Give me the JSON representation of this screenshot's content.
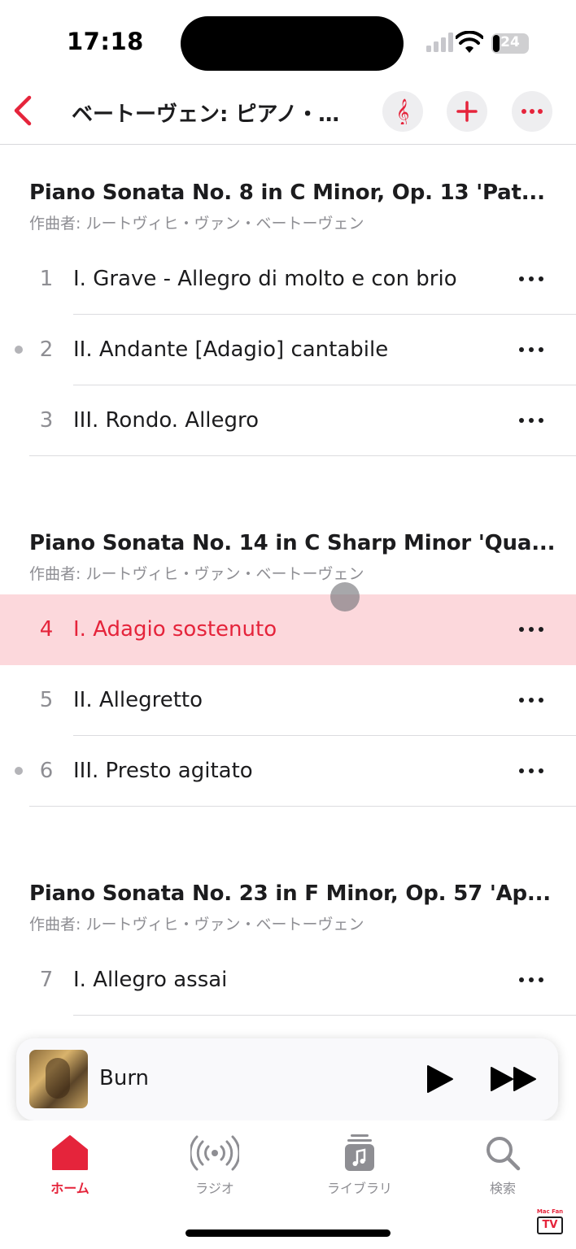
{
  "status_bar": {
    "time": "17:18",
    "battery": "24"
  },
  "nav": {
    "title": "ベートーヴェン: ピアノ・…"
  },
  "sections": [
    {
      "title": "Piano Sonata No. 8 in C Minor, Op. 13 'Pat...",
      "composer": "作曲者: ルートヴィヒ・ヴァン・ベートーヴェン",
      "tracks": [
        {
          "num": "1",
          "name": "I. Grave - Allegro di molto e con brio"
        },
        {
          "num": "2",
          "name": "II. Andante [Adagio] cantabile"
        },
        {
          "num": "3",
          "name": "III. Rondo. Allegro"
        }
      ]
    },
    {
      "title": "Piano Sonata No. 14 in C Sharp Minor 'Qua...",
      "composer": "作曲者: ルートヴィヒ・ヴァン・ベートーヴェン",
      "tracks": [
        {
          "num": "4",
          "name": "I. Adagio sostenuto"
        },
        {
          "num": "5",
          "name": "II. Allegretto"
        },
        {
          "num": "6",
          "name": "III. Presto agitato"
        }
      ]
    },
    {
      "title": "Piano Sonata No. 23 in F Minor, Op. 57 'Ap...",
      "composer": "作曲者: ルートヴィヒ・ヴァン・ベートーヴェン",
      "tracks": [
        {
          "num": "7",
          "name": "I. Allegro assai"
        }
      ]
    }
  ],
  "now_playing": {
    "title": "Burn"
  },
  "tabs": [
    {
      "label": "ホーム",
      "icon": "home-icon"
    },
    {
      "label": "ラジオ",
      "icon": "radio-icon"
    },
    {
      "label": "ライブラリ",
      "icon": "library-icon"
    },
    {
      "label": "検索",
      "icon": "search-icon"
    }
  ],
  "watermark": {
    "line1": "Mac Fan",
    "line2": "TV"
  },
  "colors": {
    "accent": "#e5243b",
    "highlight": "#fcd8dc",
    "secondary_text": "#8e8e93"
  }
}
